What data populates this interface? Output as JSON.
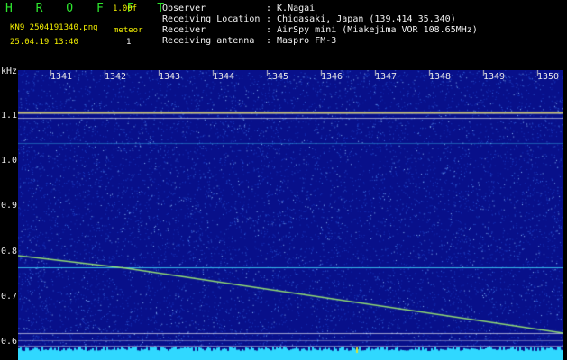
{
  "header": {
    "logo": "H R O F F T",
    "version": "1.00f",
    "filename": "KN9_2504191340.png",
    "meteor_label": "meteor",
    "timestamp": "25.04.19 13:40",
    "meteor_count": "1",
    "fields": [
      {
        "label": "Observer",
        "value": ": K.Nagai"
      },
      {
        "label": "Receiving Location",
        "value": ": Chigasaki, Japan (139.414 35.340)"
      },
      {
        "label": "Receiver",
        "value": ": AirSpy mini (Miakejima VOR 108.65MHz)"
      },
      {
        "label": "Receiving antenna",
        "value": ": Maspro FM-3"
      }
    ]
  },
  "spectrogram": {
    "y_unit": "kHz",
    "y_ticks": [
      "1.1",
      "1.0",
      "0.9",
      "0.8",
      "0.7",
      "0.6"
    ],
    "x_ticks": [
      "1341",
      "1342",
      "1343",
      "1344",
      "1345",
      "1346",
      "1347",
      "1348",
      "1349",
      "1350"
    ],
    "colors": {
      "background": "#08108a",
      "noise_bright": "#5aa0ff",
      "carrier": "#c8c070",
      "trace": "#a0f070",
      "cyan_line": "#40e0ff",
      "white_line": "#ffffff"
    }
  }
}
